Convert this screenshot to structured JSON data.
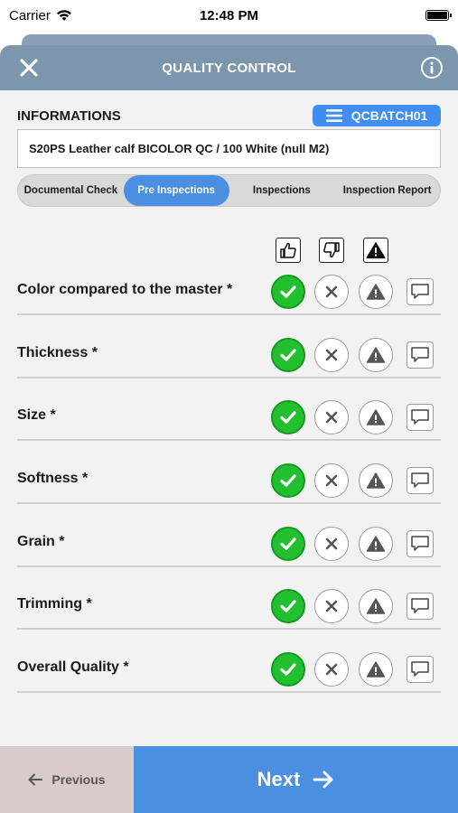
{
  "status_bar": {
    "carrier": "Carrier",
    "time": "12:48 PM"
  },
  "header": {
    "title": "QUALITY CONTROL"
  },
  "info": {
    "label": "INFORMATIONS",
    "batch_code": "QCBATCH01",
    "description": "S20PS Leather calf BICOLOR QC / 100 White (null M2)"
  },
  "tabs": [
    {
      "label": "Documental Check",
      "active": false
    },
    {
      "label": "Pre Inspections",
      "active": true
    },
    {
      "label": "Inspections",
      "active": false
    },
    {
      "label": "Inspection Report",
      "active": false
    }
  ],
  "column_icons": [
    "thumbs-up-icon",
    "thumbs-down-icon",
    "warning-icon"
  ],
  "checks": [
    {
      "label": "Color compared to the master *",
      "status": "ok"
    },
    {
      "label": "Thickness *",
      "status": "ok"
    },
    {
      "label": "Size *",
      "status": "ok"
    },
    {
      "label": "Softness *",
      "status": "ok"
    },
    {
      "label": "Grain *",
      "status": "ok"
    },
    {
      "label": "Trimming *",
      "status": "ok"
    },
    {
      "label": "Overall Quality *",
      "status": "ok"
    }
  ],
  "footer": {
    "previous_label": "Previous",
    "next_label": "Next"
  },
  "colors": {
    "header": "#7c96ad",
    "accent": "#4a8fe0",
    "ok_green": "#22c02f",
    "previous_bg": "#d9cbca"
  }
}
